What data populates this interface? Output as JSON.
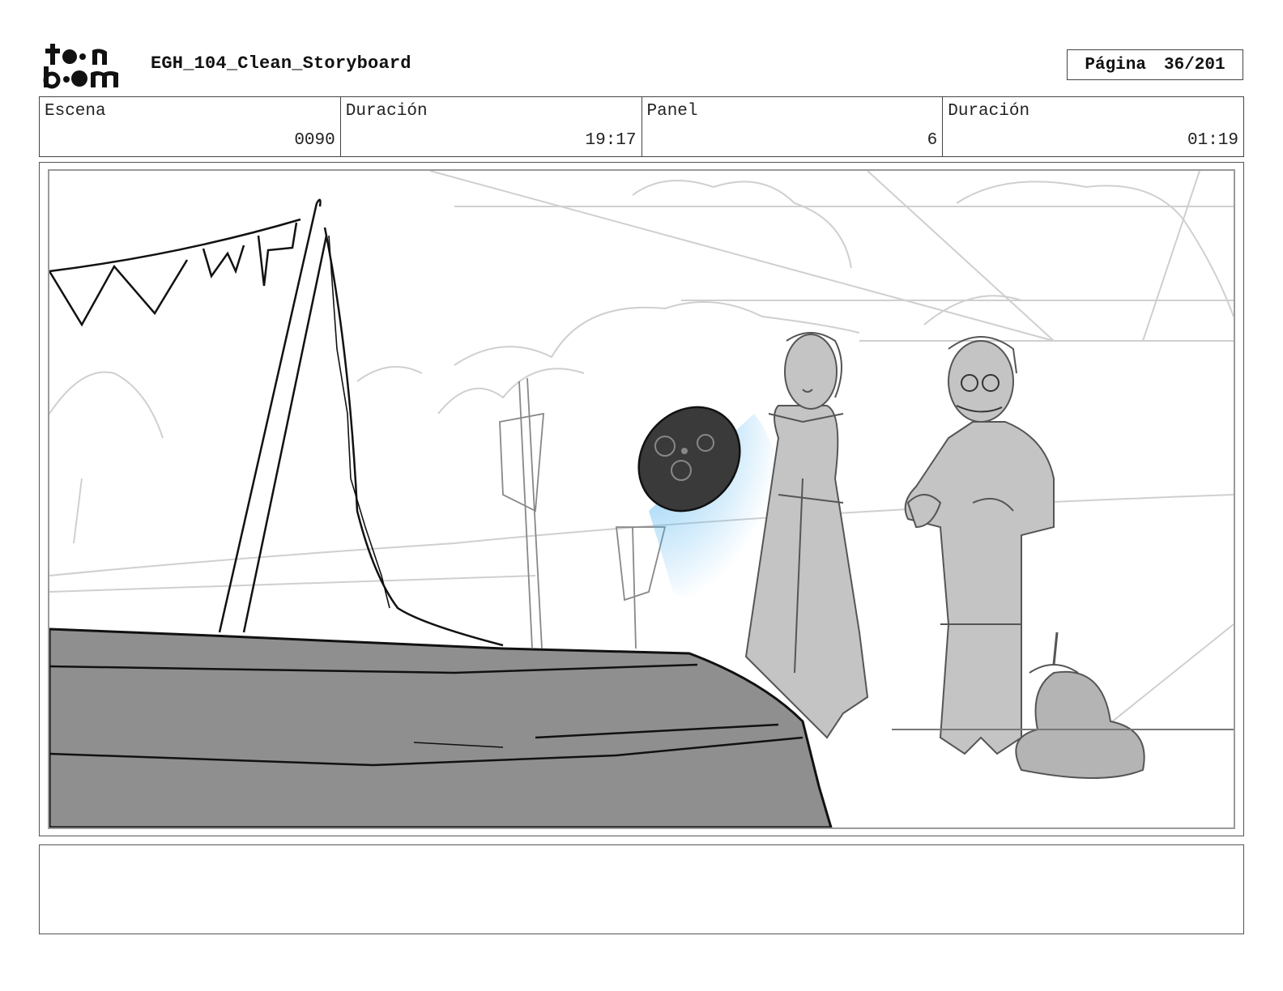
{
  "header": {
    "logo_text_top": "toon",
    "logo_text_bottom": "boom",
    "title": "EGH_104_Clean_Storyboard",
    "page_label": "Página",
    "page_value": "36/201"
  },
  "info": {
    "scene_label": "Escena",
    "scene_value": "0090",
    "scene_duration_label": "Duración",
    "scene_duration_value": "19:17",
    "panel_label": "Panel",
    "panel_value": "6",
    "panel_duration_label": "Duración",
    "panel_duration_value": "01:19"
  },
  "panel": {
    "accent_color": "#4fb2f0",
    "boat_color": "#8f8f8f",
    "character_fill": "#c4c4c4"
  },
  "notes": {
    "text": ""
  }
}
